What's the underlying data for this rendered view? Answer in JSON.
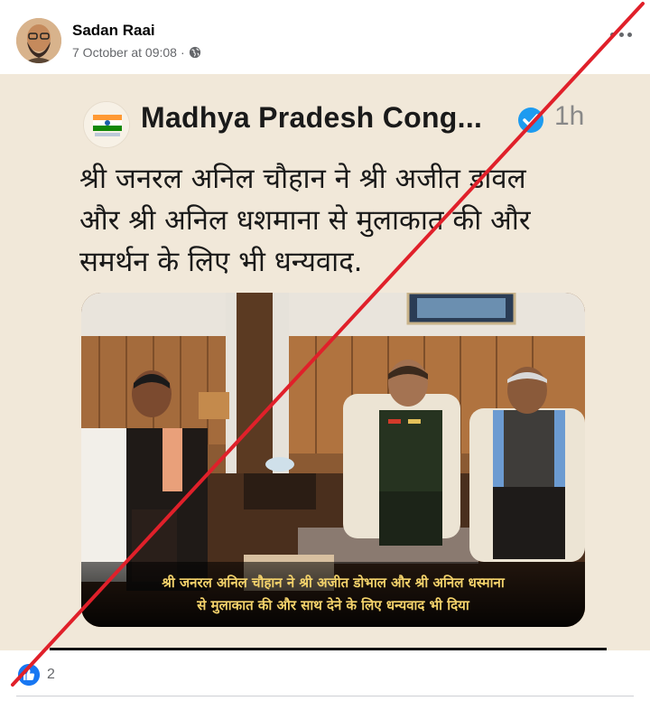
{
  "post": {
    "author": "Sadan Raai",
    "timestamp": "7 October at 09:08",
    "privacy_icon": "globe-icon",
    "more_icon": "more-options-icon"
  },
  "tweet": {
    "account_name": "Madhya Pradesh Cong...",
    "verified_icon": "verified-badge-icon",
    "time_ago": "1h",
    "text_lines": [
      "श्री जनरल अनिल चौहान ने श्री अजीत डावल",
      "और श्री अनिल धशमाना से मुलाकात की और",
      "समर्थन के लिए भी धन्यवाद."
    ],
    "photo_caption_lines": [
      "श्री जनरल अनिल चौहान ने श्री अजीत डोभाल और श्री अनिल धस्माना",
      "से मुलाकात की और साथ देने के लिए धन्यवाद भी दिया"
    ]
  },
  "footer": {
    "like_icon": "like-reaction-icon",
    "like_count": "2"
  },
  "colors": {
    "fact_check_cross": "#e0202a",
    "facebook_blue": "#1877f2",
    "caption_text": "#f3d26b"
  }
}
